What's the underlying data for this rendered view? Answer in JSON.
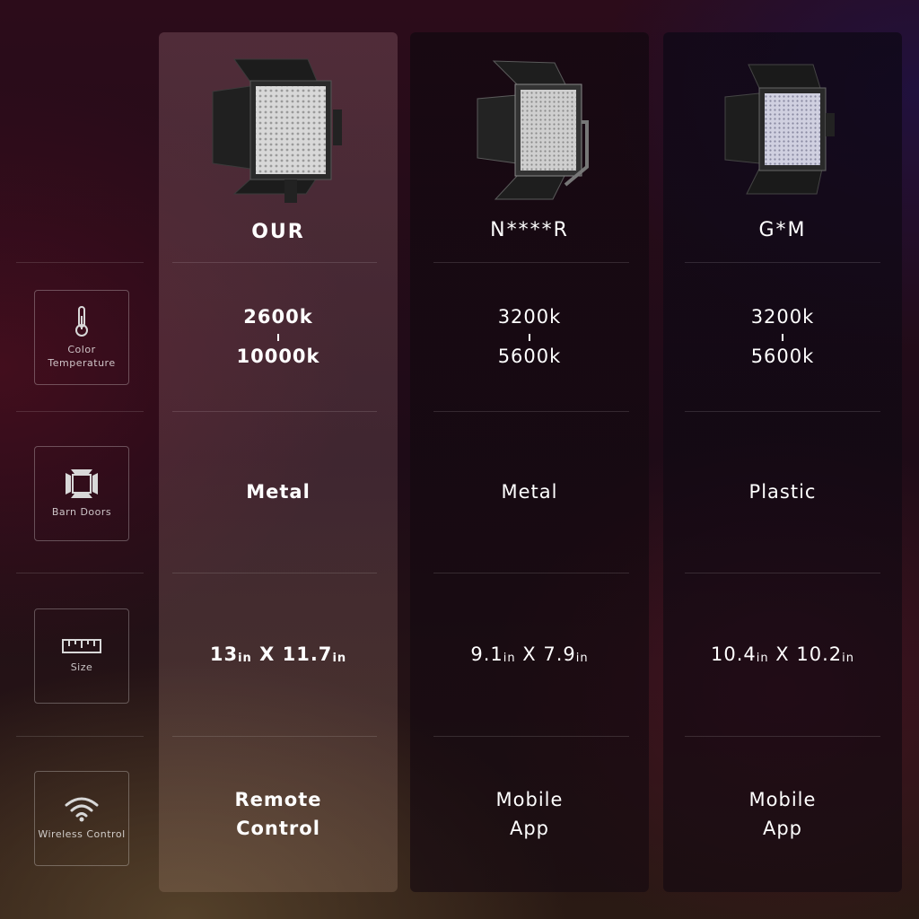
{
  "products": [
    {
      "name": "OUR"
    },
    {
      "name": "N****R"
    },
    {
      "name": "G*M"
    }
  ],
  "features": [
    {
      "label": "Color Temperature",
      "icon": "thermometer-icon"
    },
    {
      "label": "Barn Doors",
      "icon": "barn-doors-icon"
    },
    {
      "label": "Size",
      "icon": "ruler-icon"
    },
    {
      "label": "Wireless Control",
      "icon": "wifi-icon"
    }
  ],
  "rows": {
    "color_temp": [
      {
        "low": "2600k",
        "high": "10000k"
      },
      {
        "low": "3200k",
        "high": "5600k"
      },
      {
        "low": "3200k",
        "high": "5600k"
      }
    ],
    "barn_doors": [
      "Metal",
      "Metal",
      "Plastic"
    ],
    "size": [
      {
        "w": "13",
        "h": "11.7",
        "unit": "in",
        "sep": "X"
      },
      {
        "w": "9.1",
        "h": "7.9",
        "unit": "in",
        "sep": "X"
      },
      {
        "w": "10.4",
        "h": "10.2",
        "unit": "in",
        "sep": "X"
      }
    ],
    "wireless": [
      {
        "line1": "Remote",
        "line2": "Control"
      },
      {
        "line1": "Mobile",
        "line2": "App"
      },
      {
        "line1": "Mobile",
        "line2": "App"
      }
    ]
  }
}
